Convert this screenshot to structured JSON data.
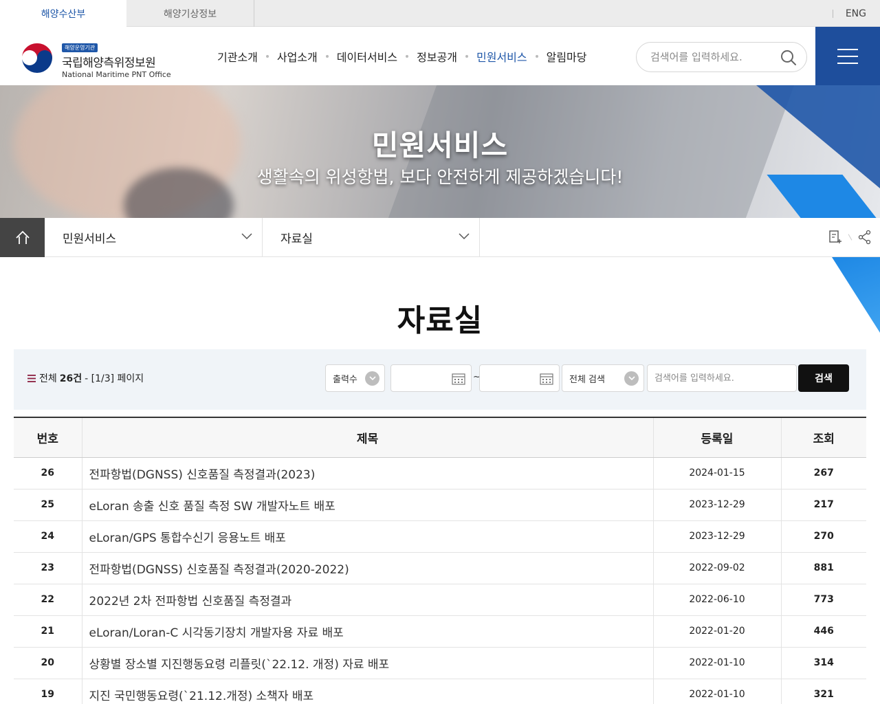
{
  "topbar": {
    "tabs": [
      "해양수산부",
      "해양기상정보"
    ],
    "lang": "ENG"
  },
  "logo": {
    "badge": "해양운영기관",
    "name": "국립해양측위정보원",
    "name_en": "National Maritime PNT Office"
  },
  "gnb": {
    "items": [
      "기관소개",
      "사업소개",
      "데이터서비스",
      "정보공개",
      "민원서비스",
      "알림마당"
    ],
    "active": "민원서비스"
  },
  "header_search": {
    "placeholder": "검색어를 입력하세요."
  },
  "hero": {
    "title": "민원서비스",
    "subtitle": "생활속의 위성항법, 보다 안전하게 제공하겠습니다!"
  },
  "location": {
    "level1": "민원서비스",
    "level2": "자료실"
  },
  "page_title": "자료실",
  "search": {
    "count_prefix": "전체",
    "count": "26건",
    "page_info": "- [1/3] 페이지",
    "per_page_label": "출력수",
    "date_from": "",
    "date_to": "",
    "tilde": "~",
    "scope_label": "전체 검색",
    "keyword_placeholder": "검색어를 입력하세요.",
    "button": "검색"
  },
  "table": {
    "headers": [
      "번호",
      "제목",
      "등록일",
      "조회"
    ],
    "rows": [
      {
        "no": "26",
        "title": "전파항법(DGNSS) 신호품질 측정결과(2023)",
        "date": "2024-01-15",
        "views": "267"
      },
      {
        "no": "25",
        "title": "eLoran 송출 신호 품질 측정 SW 개발자노트 배포",
        "date": "2023-12-29",
        "views": "217"
      },
      {
        "no": "24",
        "title": "eLoran/GPS 통합수신기 응용노트 배포",
        "date": "2023-12-29",
        "views": "270"
      },
      {
        "no": "23",
        "title": "전파항법(DGNSS) 신호품질 측정결과(2020-2022)",
        "date": "2022-09-02",
        "views": "881"
      },
      {
        "no": "22",
        "title": "2022년 2차 전파항법 신호품질 측정결과",
        "date": "2022-06-10",
        "views": "773"
      },
      {
        "no": "21",
        "title": "eLoran/Loran-C 시각동기장치 개발자용 자료 배포",
        "date": "2022-01-20",
        "views": "446"
      },
      {
        "no": "20",
        "title": "상황별 장소별 지진행동요령 리플릿(`22.12. 개정) 자료 배포",
        "date": "2022-01-10",
        "views": "314"
      },
      {
        "no": "19",
        "title": "지진 국민행동요령(`21.12.개정) 소책자 배포",
        "date": "2022-01-10",
        "views": "321"
      }
    ]
  },
  "colors": {
    "brand_blue": "#1f57a8",
    "menu_blue": "#1e4e9c",
    "accent_sky": "#1e88e5"
  }
}
